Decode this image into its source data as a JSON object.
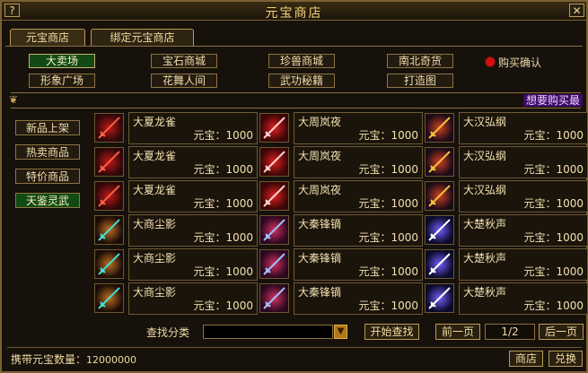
{
  "window": {
    "title": "元宝商店",
    "help": "?",
    "close": "✕"
  },
  "tabs": [
    {
      "label": "元宝商店"
    },
    {
      "label": "绑定元宝商店"
    }
  ],
  "categories": [
    "大卖场",
    "宝石商城",
    "珍兽商城",
    "南北奇货",
    "形象广场",
    "花舞人间",
    "武功秘籍",
    "打造图"
  ],
  "confirm_label": "购买确认",
  "banner_text": "想要购买最",
  "side_menu": [
    "新品上架",
    "热卖商品",
    "特价商品",
    "天鉴灵武"
  ],
  "price_label": "元宝：1000",
  "items": [
    [
      "大夏龙雀",
      "大周岚夜",
      "大汉弘纲"
    ],
    [
      "大夏龙雀",
      "大周岚夜",
      "大汉弘纲"
    ],
    [
      "大夏龙雀",
      "大周岚夜",
      "大汉弘纲"
    ],
    [
      "大商尘影",
      "大秦锋镝",
      "大楚秋声"
    ],
    [
      "大商尘影",
      "大秦锋镝",
      "大楚秋声"
    ],
    [
      "大商尘影",
      "大秦锋镝",
      "大楚秋声"
    ]
  ],
  "search": {
    "label": "查找分类",
    "value": "",
    "button": "开始查找"
  },
  "pagination": {
    "prev": "前一页",
    "page": "1/2",
    "next": "后一页"
  },
  "status": {
    "label": "携带元宝数量：",
    "value": "12000000"
  },
  "footer_buttons": {
    "shop": "商店",
    "exchange": "兑换"
  },
  "colors": {
    "gold_text": "#f3d37a",
    "selected_green": "#124a14",
    "border": "#7a6132"
  }
}
